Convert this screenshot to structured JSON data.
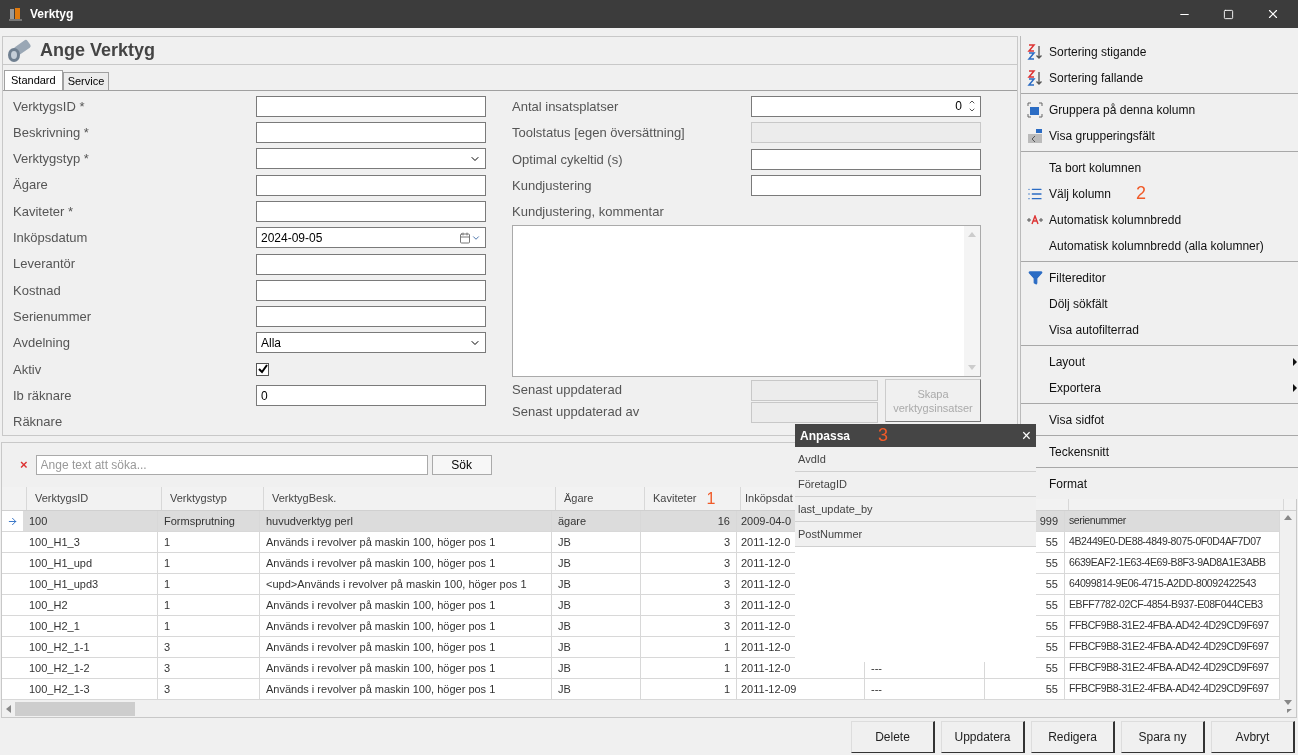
{
  "window": {
    "title": "Verktyg"
  },
  "form": {
    "title": "Ange Verktyg",
    "tabs": [
      {
        "label": "Standard",
        "selected": true
      },
      {
        "label": "Service",
        "selected": false
      }
    ],
    "left_fields": [
      {
        "label": "VerktygsID *",
        "kind": "text"
      },
      {
        "label": "Beskrivning *",
        "kind": "text"
      },
      {
        "label": "Verktygstyp *",
        "kind": "select"
      },
      {
        "label": "Ägare",
        "kind": "text"
      },
      {
        "label": "Kaviteter *",
        "kind": "text"
      },
      {
        "label": "Inköpsdatum",
        "kind": "date",
        "value": "2024-09-05"
      },
      {
        "label": "Leverantör",
        "kind": "text"
      },
      {
        "label": "Kostnad",
        "kind": "text"
      },
      {
        "label": "Serienummer",
        "kind": "text"
      },
      {
        "label": "Avdelning",
        "kind": "select",
        "value": "Alla"
      },
      {
        "label": "Aktiv",
        "kind": "checkbox",
        "checked": true
      },
      {
        "label": "Ib räknare",
        "kind": "text",
        "value": "0"
      },
      {
        "label": "Räknare",
        "kind": "none"
      }
    ],
    "right_fields": [
      {
        "label": "Antal insatsplatser",
        "kind": "spin",
        "value": "0"
      },
      {
        "label": "Toolstatus [egen översättning]",
        "kind": "text",
        "disabled": true
      },
      {
        "label": "Optimal cykeltid (s)",
        "kind": "text",
        "disabled": false
      },
      {
        "label": "Kundjustering",
        "kind": "text",
        "disabled": false
      },
      {
        "label": "Kundjustering, kommentar",
        "kind": "textarea"
      }
    ],
    "footer_fields": [
      {
        "label": "Senast uppdaterad",
        "disabled": true
      },
      {
        "label": "Senast uppdaterad av",
        "disabled": true
      }
    ],
    "action_button": {
      "label": "Skapa verktygsinsatser",
      "disabled": true
    }
  },
  "search": {
    "clear": "×",
    "placeholder": "Ange text att söka...",
    "button": "Sök"
  },
  "grid": {
    "columns": [
      {
        "label": "VerktygsID"
      },
      {
        "label": "Verktygstyp"
      },
      {
        "label": "VerktygBesk."
      },
      {
        "label": "Ägare"
      },
      {
        "label": "Kaviteter",
        "annotation": "1"
      },
      {
        "label": "Inköpsdat"
      }
    ],
    "rows": [
      {
        "selected": true,
        "cells": [
          "100",
          "Formsprutning",
          "huvudverktyg perl",
          "ägare",
          "16",
          "2009-04-0"
        ],
        "column_8": "999",
        "column_9": "serienummer"
      },
      {
        "selected": false,
        "cells": [
          "100_H1_3",
          "1",
          "Används i revolver på maskin 100, höger pos 1",
          "JB",
          "3",
          "2011-12-0"
        ],
        "column_8": "55",
        "column_9": "4B2449E0-DE88-4849-8075-0F0D4AF7D07"
      },
      {
        "selected": false,
        "cells": [
          "100_H1_upd",
          "1",
          "Används i revolver på maskin 100, höger pos 1",
          "JB",
          "3",
          "2011-12-0"
        ],
        "column_8": "55",
        "column_9": "6639EAF2-1E63-4E69-B8F3-9AD8A1E3ABB"
      },
      {
        "selected": false,
        "cells": [
          "100_H1_upd3",
          "1",
          "<upd>Används i revolver på maskin 100, höger pos 1",
          "JB",
          "3",
          "2011-12-0"
        ],
        "column_8": "55",
        "column_9": "64099814-9E06-4715-A2DD-80092422543"
      },
      {
        "selected": false,
        "cells": [
          "100_H2",
          "1",
          "Används i revolver på maskin 100, höger pos 1",
          "JB",
          "3",
          "2011-12-0"
        ],
        "column_8": "55",
        "column_9": "EBFF7782-02CF-4854-B937-E08F044CEB3"
      },
      {
        "selected": false,
        "cells": [
          "100_H2_1",
          "1",
          "Används i revolver på maskin 100, höger pos 1",
          "JB",
          "3",
          "2011-12-0"
        ],
        "column_8": "55",
        "column_9": "FFBCF9B8-31E2-4FBA-AD42-4D29CD9F697"
      },
      {
        "selected": false,
        "cells": [
          "100_H2_1-1",
          "3",
          "Används i revolver på maskin 100, höger pos 1",
          "JB",
          "1",
          "2011-12-0"
        ],
        "column_8": "55",
        "column_9": "FFBCF9B8-31E2-4FBA-AD42-4D29CD9F697"
      },
      {
        "selected": false,
        "cells": [
          "100_H2_1-2",
          "3",
          "Används i revolver på maskin 100, höger pos 1",
          "JB",
          "1",
          "2011-12-0"
        ],
        "column_7": "---",
        "column_8": "55",
        "column_9": "FFBCF9B8-31E2-4FBA-AD42-4D29CD9F697"
      },
      {
        "selected": false,
        "cells": [
          "100_H2_1-3",
          "3",
          "Används i revolver på maskin 100, höger pos 1",
          "JB",
          "1",
          "2011-12-09"
        ],
        "column_7": "---",
        "column_8": "55",
        "column_9": "FFBCF9B8-31E2-4FBA-AD42-4D29CD9F697"
      }
    ]
  },
  "buttons": [
    "Delete",
    "Uppdatera",
    "Redigera",
    "Spara ny",
    "Avbryt"
  ],
  "context_menu": {
    "groups": [
      [
        {
          "label": "Sortering stigande",
          "kind": "sort-asc"
        },
        {
          "label": "Sortering fallande",
          "kind": "sort-desc"
        }
      ],
      [
        {
          "label": "Gruppera på denna kolumn",
          "kind": "group"
        },
        {
          "label": "Visa grupperingsfält",
          "kind": "group-panel"
        }
      ],
      [
        {
          "label": "Ta bort kolumnen",
          "kind": "plain"
        },
        {
          "label": "Välj kolumn",
          "kind": "columns",
          "annotation": "2"
        },
        {
          "label": "Automatisk kolumnbredd",
          "kind": "autofit"
        },
        {
          "label": "Automatisk kolumnbredd (alla kolumner)",
          "kind": "plain"
        }
      ],
      [
        {
          "label": "Filtereditor",
          "kind": "filter"
        },
        {
          "label": "Dölj sökfält",
          "kind": "plain"
        },
        {
          "label": "Visa autofilterrad",
          "kind": "plain"
        }
      ],
      [
        {
          "label": "Layout",
          "kind": "submenu"
        },
        {
          "label": "Exportera",
          "kind": "submenu"
        }
      ],
      [
        {
          "label": "Visa sidfot",
          "kind": "plain"
        }
      ],
      [
        {
          "label": "Teckensnitt",
          "kind": "plain"
        }
      ],
      [
        {
          "label": "Format",
          "kind": "plain"
        }
      ]
    ]
  },
  "customize_popup": {
    "title": "Anpassa",
    "annotation": "3",
    "close": "×",
    "items": [
      "AvdId",
      "FöretagID",
      "last_update_by",
      "PostNummer"
    ]
  }
}
